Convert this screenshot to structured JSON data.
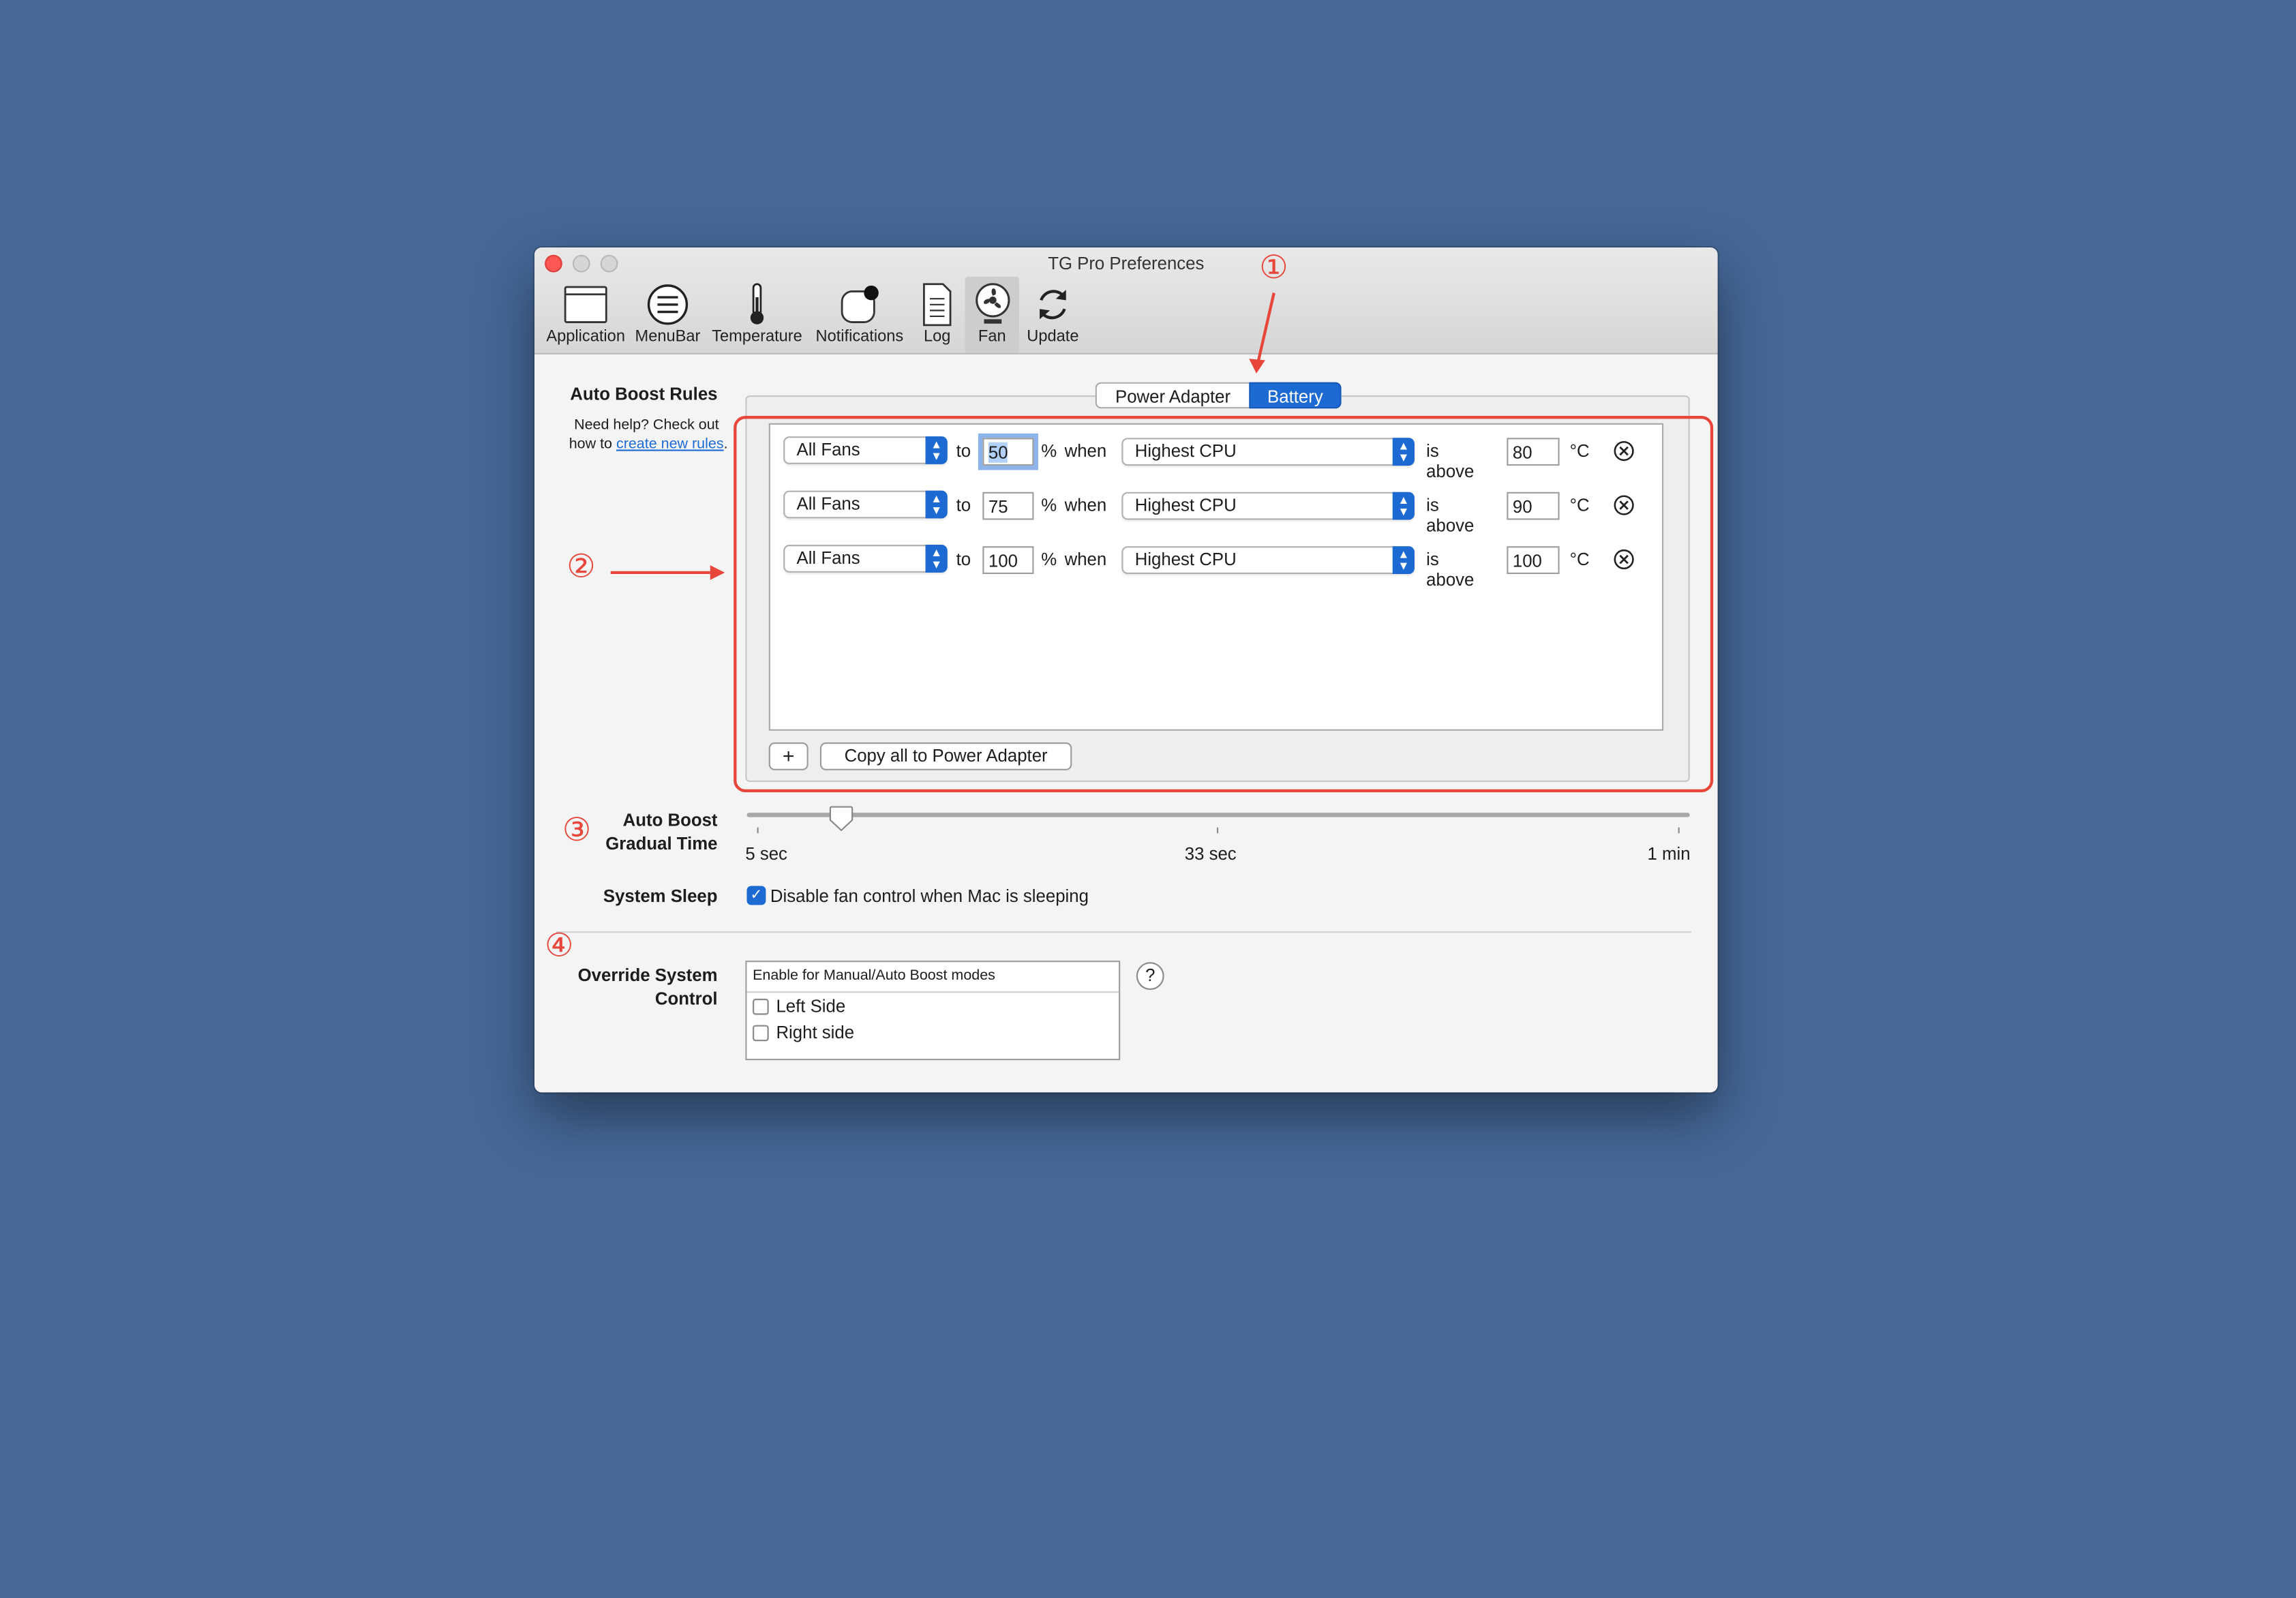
{
  "window": {
    "title": "TG Pro Preferences"
  },
  "toolbar": [
    {
      "label": "Application",
      "icon": "application-icon"
    },
    {
      "label": "MenuBar",
      "icon": "menubar-icon"
    },
    {
      "label": "Temperature",
      "icon": "thermometer-icon"
    },
    {
      "label": "Notifications",
      "icon": "notifications-icon"
    },
    {
      "label": "Log",
      "icon": "log-icon"
    },
    {
      "label": "Fan",
      "icon": "fan-icon",
      "selected": true
    },
    {
      "label": "Update",
      "icon": "update-icon"
    }
  ],
  "auto_boost": {
    "title": "Auto Boost  Rules",
    "help_prefix": "Need help? Check out",
    "help_how": "how to",
    "help_link": "create new rules",
    "help_suffix": ".",
    "tabs": {
      "power": "Power Adapter",
      "battery": "Battery",
      "selected": "Battery"
    },
    "rules": [
      {
        "fans": "All Fans",
        "to": "to",
        "percent": "50",
        "pct_sign": "%",
        "when": "when",
        "sensor": "Highest CPU",
        "is_above": "is above",
        "temp": "80",
        "unit": "°C"
      },
      {
        "fans": "All Fans",
        "to": "to",
        "percent": "75",
        "pct_sign": "%",
        "when": "when",
        "sensor": "Highest CPU",
        "is_above": "is above",
        "temp": "90",
        "unit": "°C"
      },
      {
        "fans": "All Fans",
        "to": "to",
        "percent": "100",
        "pct_sign": "%",
        "when": "when",
        "sensor": "Highest CPU",
        "is_above": "is above",
        "temp": "100",
        "unit": "°C"
      }
    ],
    "add_button": "+",
    "copy_button": "Copy all to Power Adapter"
  },
  "gradual": {
    "label_line1": "Auto Boost",
    "label_line2": "Gradual Time",
    "min_label": "5 sec",
    "mid_label": "33 sec",
    "max_label": "1 min",
    "value_fraction": 0.1
  },
  "sleep": {
    "label": "System Sleep",
    "checkbox_label": "Disable fan control when Mac is sleeping",
    "checked": true
  },
  "override": {
    "label_line1": "Override System",
    "label_line2": "Control",
    "header": "Enable for Manual/Auto Boost modes",
    "left": "Left Side",
    "right": "Right side",
    "help": "?"
  },
  "annotations": {
    "one": "①",
    "two": "②",
    "three": "③",
    "four": "④"
  },
  "colors": {
    "background": "#46699a",
    "accent": "#1d6ad3",
    "annotation": "#e8463b"
  }
}
